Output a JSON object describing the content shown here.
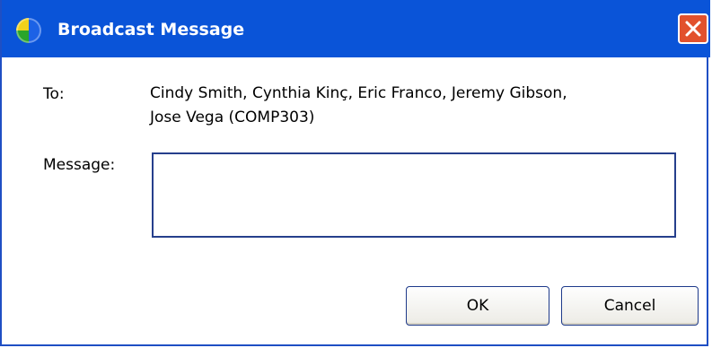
{
  "window": {
    "title": "Broadcast Message",
    "title_bar_color": "#0a54d8",
    "close_button_color": "#e2512d"
  },
  "icons": {
    "app": "app-globe-icon",
    "close": "close-icon"
  },
  "form": {
    "to_label": "To:",
    "recipients_line1": "Cindy Smith, Cynthia Kinç, Eric Franco, Jeremy Gibson,",
    "recipients_line2": "Jose Vega (COMP303)",
    "message_label": "Message:",
    "message_value": ""
  },
  "buttons": {
    "ok": "OK",
    "cancel": "Cancel"
  }
}
